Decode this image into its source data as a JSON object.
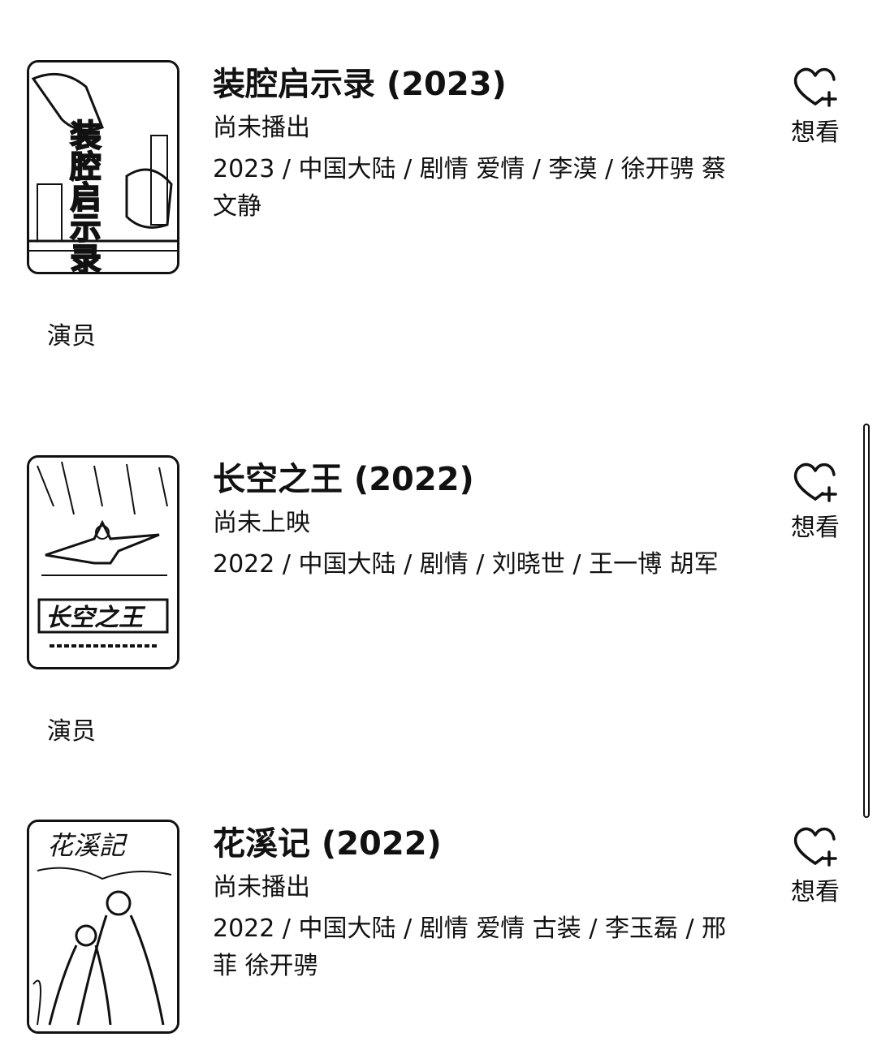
{
  "movies": [
    {
      "title": "装腔启示录 (2023)",
      "status": "尚未播出",
      "meta": "2023 / 中国大陆 / 剧情 爱情 / 李漠 / 徐开骋 蔡文静",
      "poster_text": "装腔启示录",
      "wish_label": "想看",
      "wish_icon": "heart-plus-icon",
      "cast_label": "演员"
    },
    {
      "title": "长空之王 (2022)",
      "status": "尚未上映",
      "meta": "2022 / 中国大陆 / 剧情 / 刘晓世 / 王一博 胡军",
      "poster_text": "长空之王",
      "wish_label": "想看",
      "wish_icon": "heart-plus-icon",
      "cast_label": "演员"
    },
    {
      "title": "花溪记 (2022)",
      "status": "尚未播出",
      "meta": "2022 / 中国大陆 / 剧情 爱情 古装 / 李玉磊 / 邢菲 徐开骋",
      "poster_text": "花溪記",
      "wish_label": "想看",
      "wish_icon": "heart-plus-icon"
    }
  ]
}
